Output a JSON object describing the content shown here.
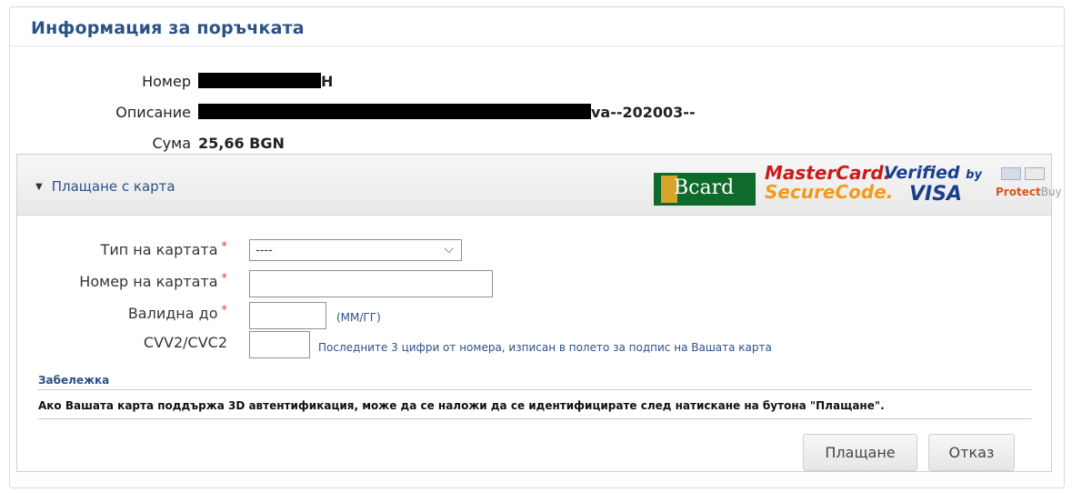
{
  "order_panel": {
    "title": "Информация за поръчката",
    "number_label": "Номер",
    "number_suffix": "H",
    "description_label": "Описание",
    "description_suffix": "va--202003--",
    "amount_label": "Сума",
    "amount_value": "25,66 BGN"
  },
  "card_section": {
    "title": "Плащане с карта",
    "logos": {
      "bcard": "Bcard",
      "mastercard_line1": "MasterCard.",
      "mastercard_line2": "SecureCode.",
      "visa_line1": "Verified",
      "visa_by": "by",
      "visa_line2": "VISA",
      "protectbuy_a": "Protect",
      "protectbuy_b": "Buy"
    },
    "colors": {
      "accent": "#2a5286",
      "required": "#e53a3a",
      "mastercard_red": "#cc1a1a",
      "mastercard_orange": "#f09b1c",
      "visa_blue": "#1a3f8f",
      "bcard_green": "#0e6b2c"
    }
  },
  "form": {
    "card_type_label": "Тип на картата",
    "card_type_value": "----",
    "card_number_label": "Номер на картата",
    "valid_until_label": "Валидна до",
    "valid_until_hint": "(ММ/ГГ)",
    "cvv_label": "CVV2/CVC2",
    "cvv_hint": "Последните 3 цифри от номера, изписан в полето за подпис на Вашата карта",
    "required_mark": "*"
  },
  "note": {
    "title": "Забележка",
    "text": "Ако Вашата карта поддържа 3D автентификация, може да се наложи да се идентифицирате след натискане на бутона \"Плащане\"."
  },
  "buttons": {
    "pay": "Плащане",
    "cancel": "Отказ"
  }
}
